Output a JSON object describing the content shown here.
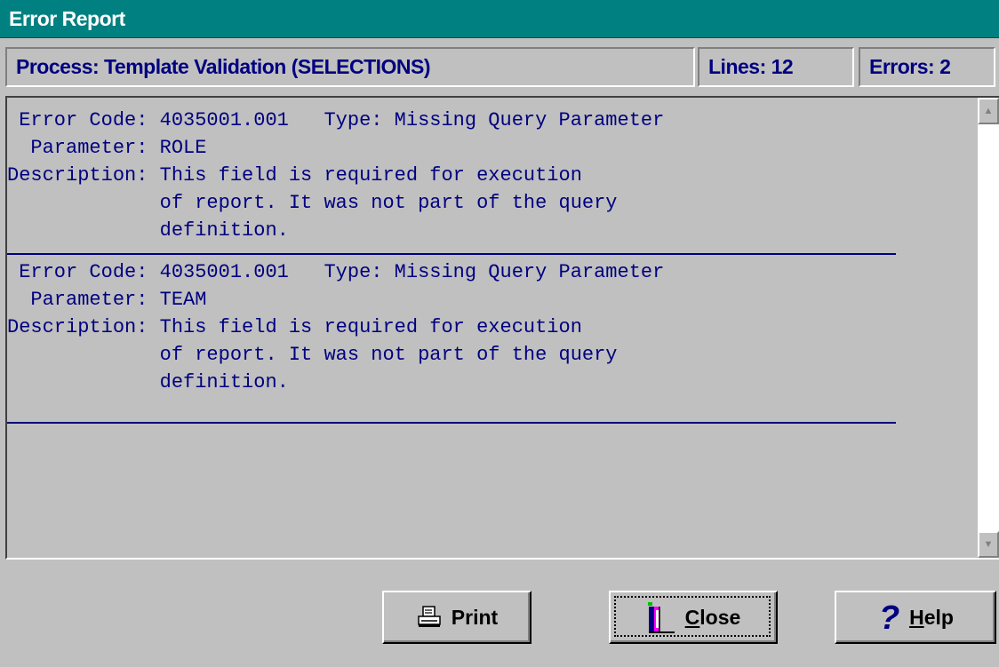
{
  "window": {
    "title": "Error Report"
  },
  "status": {
    "process": "Process: Template Validation (SELECTIONS)",
    "lines": "Lines: 12",
    "errors": "Errors: 2"
  },
  "report": {
    "entries": [
      {
        "line1": " Error Code: 4035001.001   Type: Missing Query Parameter",
        "line2": "  Parameter: ROLE",
        "line3": "Description: This field is required for execution",
        "line4": "             of report. It was not part of the query",
        "line5": "             definition."
      },
      {
        "line1": " Error Code: 4035001.001   Type: Missing Query Parameter",
        "line2": "  Parameter: TEAM",
        "line3": "Description: This field is required for execution",
        "line4": "             of report. It was not part of the query",
        "line5": "             definition."
      }
    ]
  },
  "buttons": {
    "print_label": "Print",
    "close_first": "C",
    "close_rest": "lose",
    "help_first": "H",
    "help_rest": "elp"
  },
  "icons": {
    "print": "printer-icon",
    "close": "door-exit-icon",
    "help": "question-mark-icon",
    "scroll_up": "arrow-up-icon",
    "scroll_down": "arrow-down-icon"
  },
  "colors": {
    "titlebar": "#008080",
    "text_accent": "#000080",
    "face": "#c0c0c0"
  }
}
